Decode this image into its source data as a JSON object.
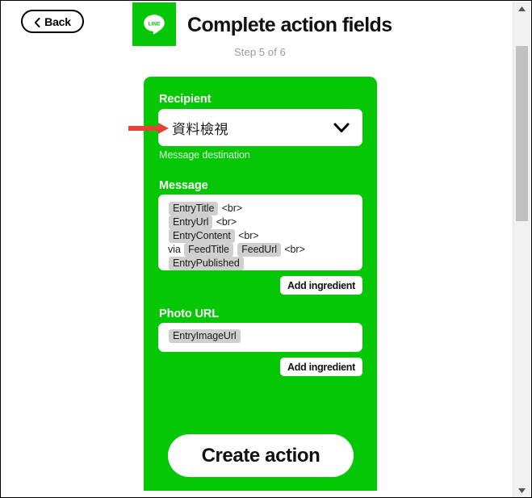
{
  "header": {
    "back_label": "Back",
    "back_icon": "chevron-left-icon",
    "logo_icon": "line-logo-icon",
    "logo_text": "LINE",
    "title": "Complete action fields",
    "step": "Step 5 of 6"
  },
  "form": {
    "recipient": {
      "label": "Recipient",
      "value": "資料檢視",
      "helper": "Message destination",
      "caret_icon": "chevron-down-icon"
    },
    "message": {
      "label": "Message",
      "lines": [
        [
          {
            "t": "chip",
            "v": "EntryTitle"
          },
          {
            "t": "text",
            "v": " <br>"
          }
        ],
        [
          {
            "t": "chip",
            "v": "EntryUrl"
          },
          {
            "t": "text",
            "v": " <br>"
          }
        ],
        [
          {
            "t": "chip",
            "v": "EntryContent"
          },
          {
            "t": "text",
            "v": " <br>"
          }
        ],
        [
          {
            "t": "text",
            "v": "via "
          },
          {
            "t": "chip",
            "v": "FeedTitle"
          },
          {
            "t": "text",
            "v": "  "
          },
          {
            "t": "chip",
            "v": "FeedUrl"
          },
          {
            "t": "text",
            "v": " <br>"
          }
        ],
        [
          {
            "t": "chip",
            "v": "EntryPublished"
          }
        ]
      ],
      "add_ingredient_label": "Add ingredient"
    },
    "photo_url": {
      "label": "Photo URL",
      "lines": [
        [
          {
            "t": "chip",
            "v": "EntryImageUrl"
          }
        ]
      ],
      "add_ingredient_label": "Add ingredient"
    },
    "submit_label": "Create action"
  },
  "annotation": {
    "arrow_icon": "red-arrow-right-icon",
    "arrow_color": "#e8413a"
  },
  "scrollbar": {
    "up_icon": "scroll-up-arrow-icon",
    "down_icon": "scroll-down-arrow-icon"
  },
  "colors": {
    "brand_green": "#06c706",
    "chip_gray": "#cfcfcf",
    "helper_gray": "#9a9a9a"
  }
}
